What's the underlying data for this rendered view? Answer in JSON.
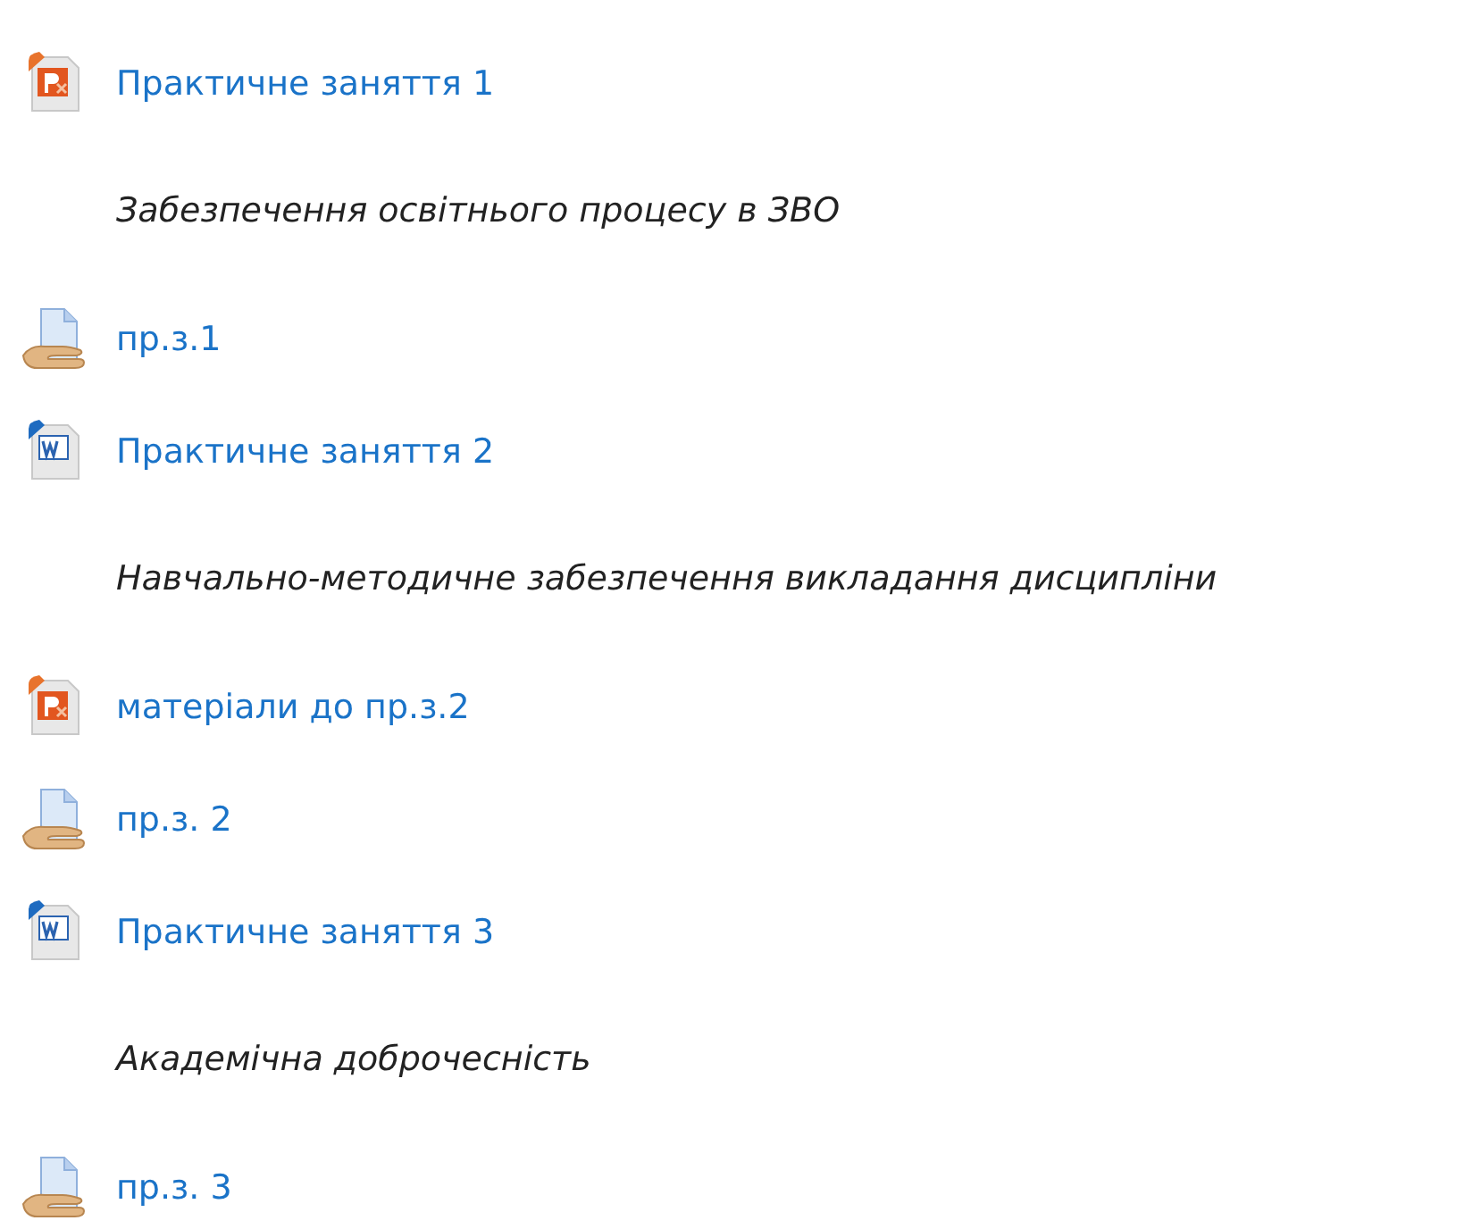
{
  "activities": [
    {
      "kind": "presentation",
      "label": "Практичне заняття 1",
      "description": "Забезпечення освітнього процесу в ЗВО"
    },
    {
      "kind": "assignment",
      "label": "пр.з.1"
    },
    {
      "kind": "document",
      "label": "Практичне заняття 2",
      "description": "Навчально-методичне забезпечення викладання дисципліни"
    },
    {
      "kind": "presentation",
      "label": "матеріали до пр.з.2"
    },
    {
      "kind": "assignment",
      "label": "пр.з. 2"
    },
    {
      "kind": "document",
      "label": "Практичне заняття 3",
      "description": "Академічна доброчесність"
    },
    {
      "kind": "assignment",
      "label": "пр.з. 3"
    }
  ]
}
